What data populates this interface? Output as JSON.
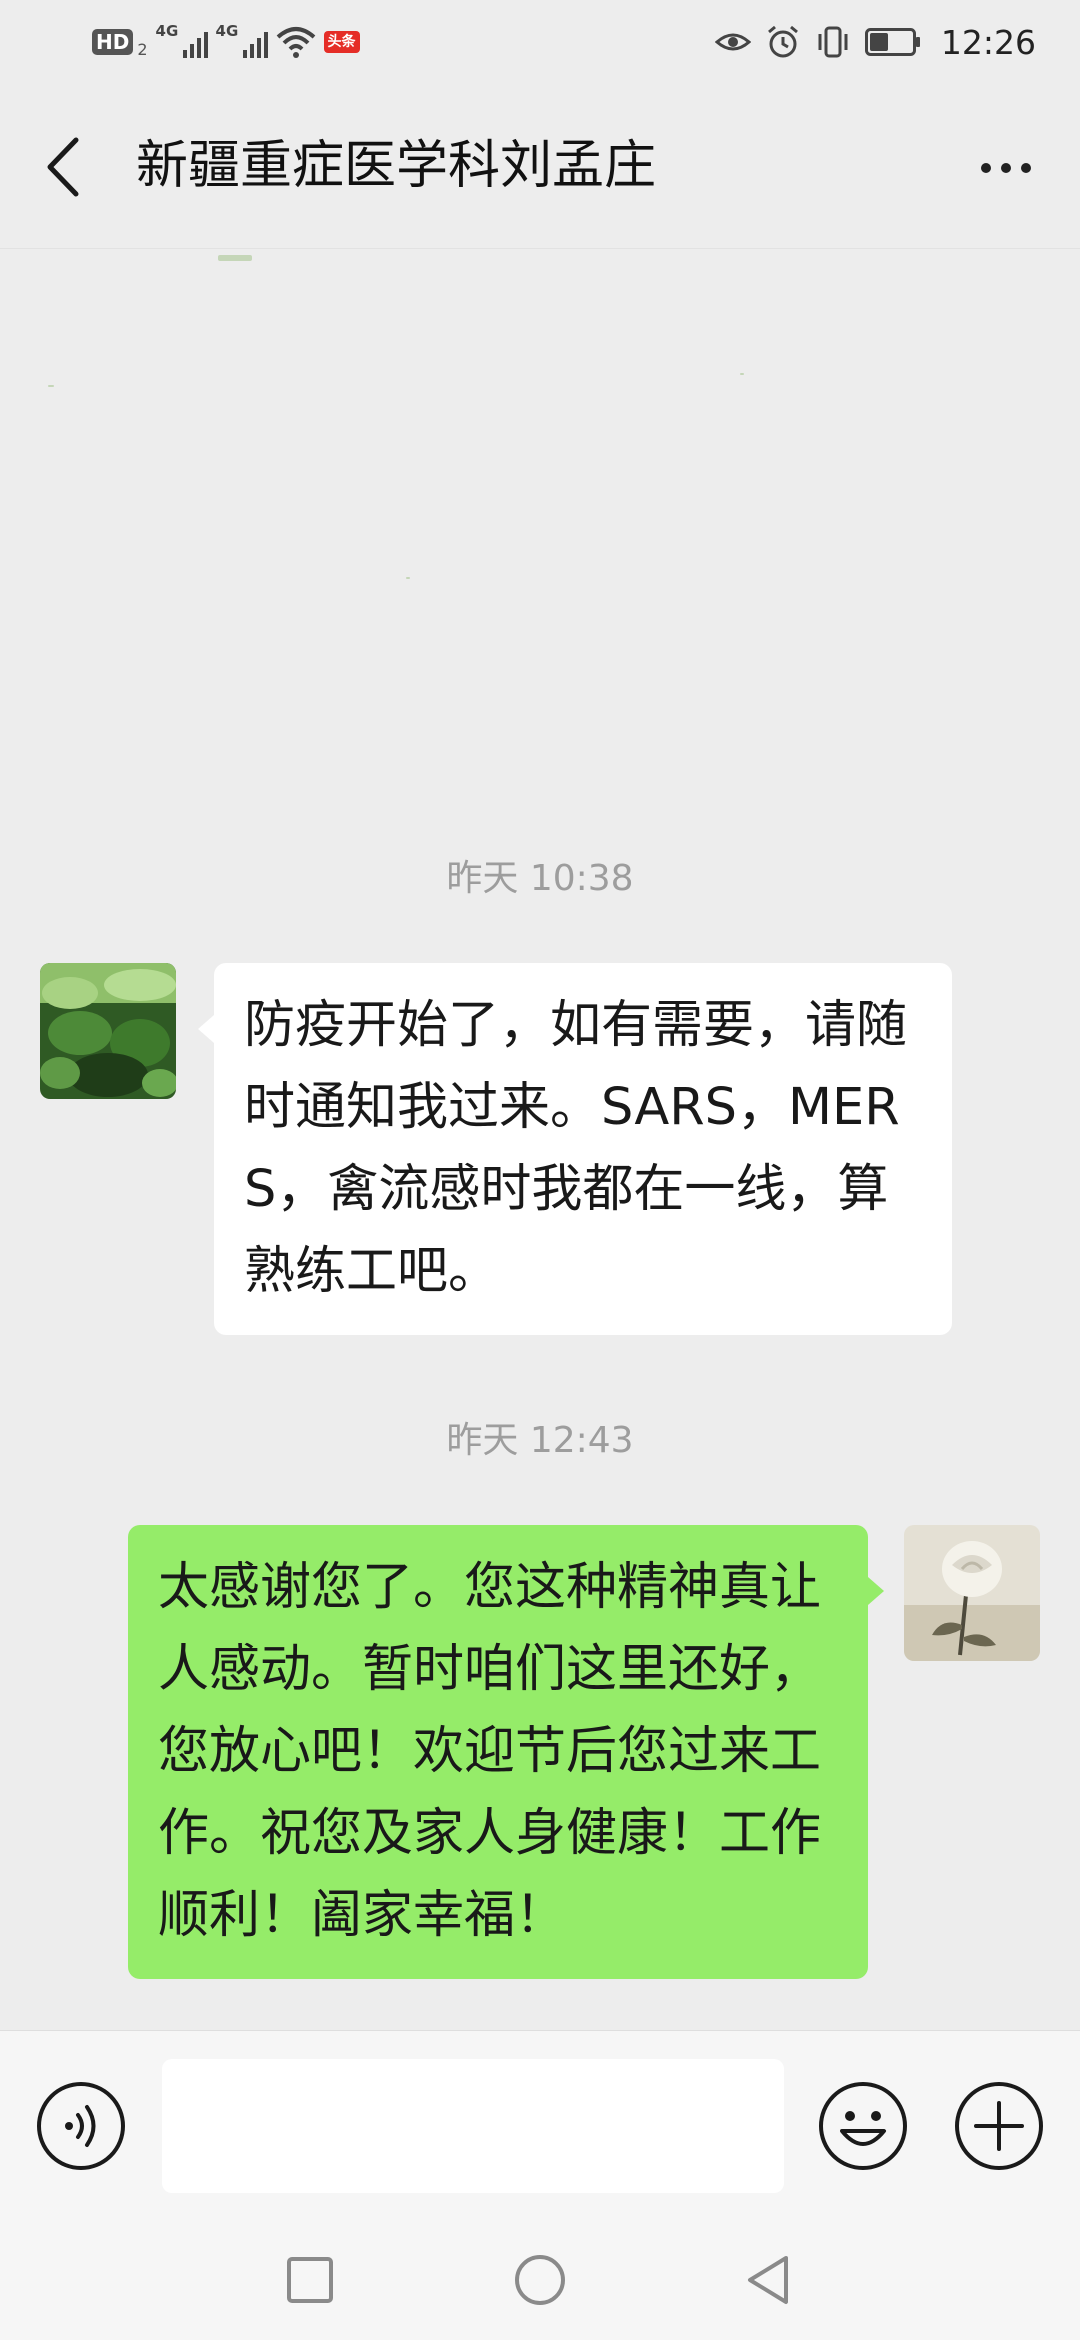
{
  "status_bar": {
    "hd_label": "HD",
    "hd_sub": "2",
    "network1": "4G",
    "network2": "4G",
    "news_badge": "头条",
    "time": "12:26",
    "battery_level": 0.45
  },
  "header": {
    "title": "新疆重症医学科刘孟庄"
  },
  "messages": [
    {
      "timestamp": "昨天 10:38",
      "side": "left",
      "text": "防疫开始了，如有需要，请随时通知我过来。SARS，MERS，禽流感时我都在一线，算熟练工吧。"
    },
    {
      "timestamp": "昨天 12:43",
      "side": "right",
      "text": "太感谢您了。您这种精神真让人感动。暂时咱们这里还好，您放心吧！欢迎节后您过来工作。祝您及家人身健康！工作顺利！阖家幸福！"
    }
  ],
  "input": {
    "value": "",
    "placeholder": ""
  },
  "colors": {
    "background": "#ededed",
    "incoming_bubble": "#ffffff",
    "outgoing_bubble": "#95ec69",
    "timestamp": "#9d9d9d"
  },
  "icons": [
    "back-icon",
    "more-icon",
    "voice-icon",
    "emoji-icon",
    "plus-icon",
    "recent-apps-icon",
    "home-icon",
    "back-nav-icon"
  ]
}
